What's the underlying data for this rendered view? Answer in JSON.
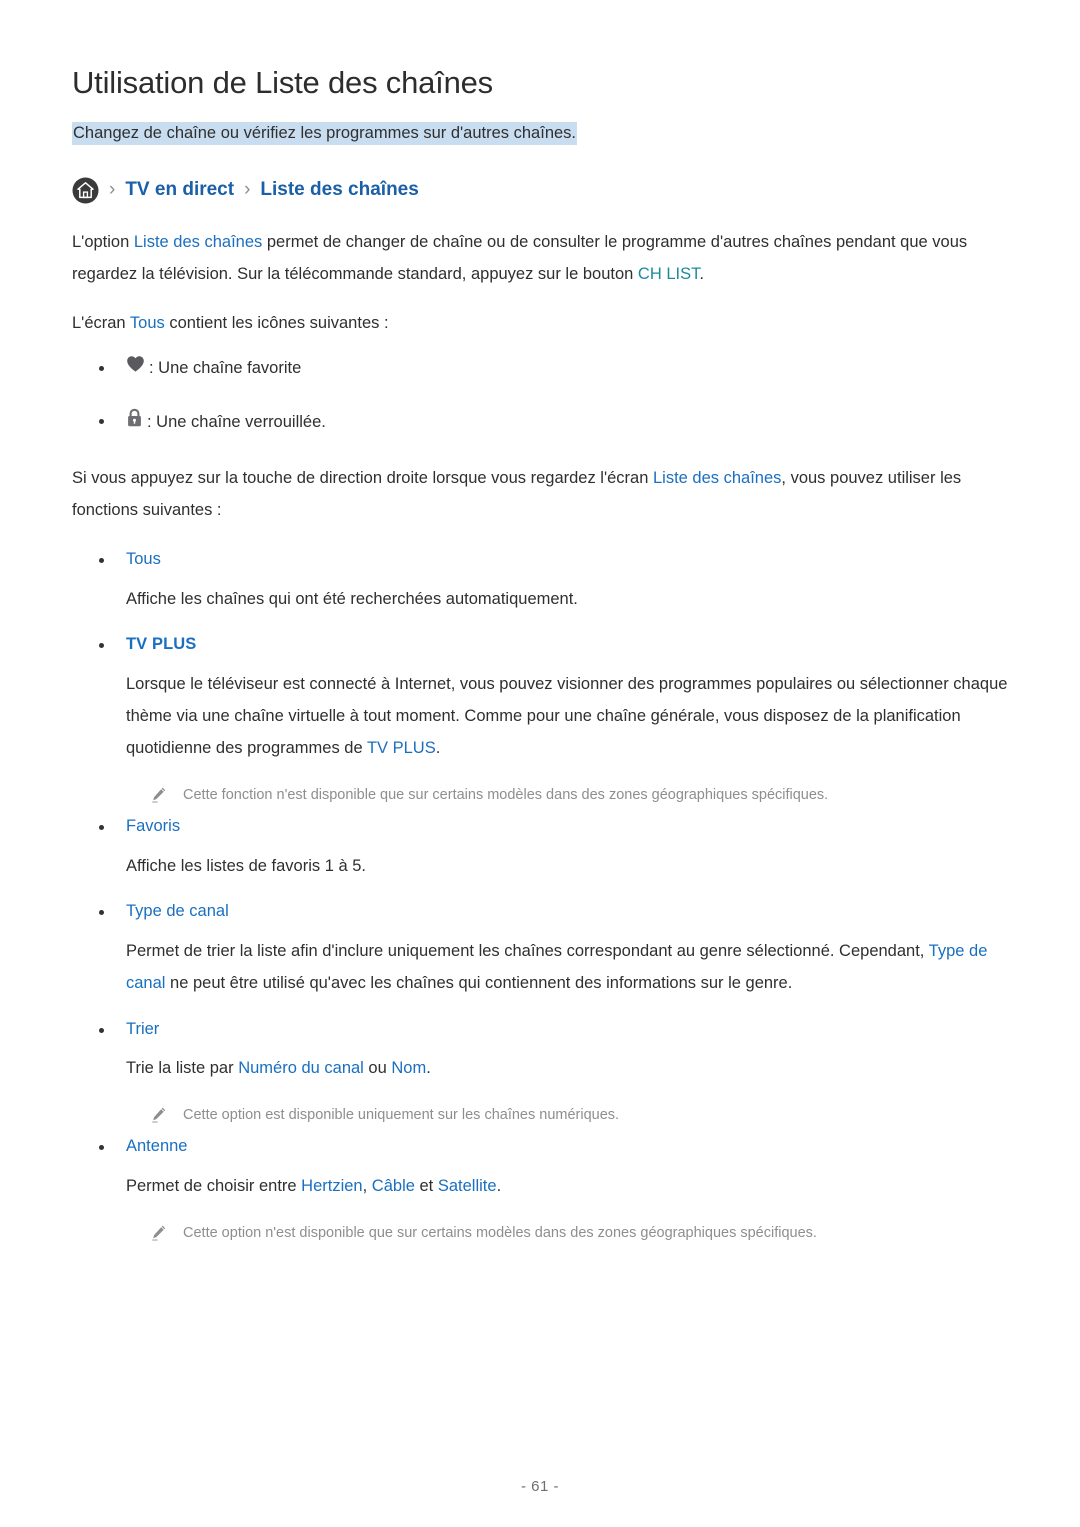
{
  "page": {
    "title": "Utilisation de Liste des chaînes",
    "subtitle": "Changez de chaîne ou vérifiez les programmes sur d'autres chaînes.",
    "footer": "- 61 -"
  },
  "colors": {
    "link": "#1a6fc0",
    "breadcrumb": "#1a5fa8",
    "teal": "#1b8a9c",
    "highlight": "#c9ddf1",
    "note_text": "#8e8e8e",
    "body_text": "#2f2f2f"
  },
  "breadcrumb": {
    "home_icon": "home-icon",
    "separator": "›",
    "items": [
      {
        "label": "TV en direct"
      },
      {
        "label": "Liste des chaînes"
      }
    ]
  },
  "intro": {
    "p1_part1": "L'option ",
    "p1_link1": "Liste des chaînes",
    "p1_part2": " permet de changer de chaîne ou de consulter le programme d'autres chaînes pendant que vous regardez la télévision. Sur la télécommande standard, appuyez sur le bouton ",
    "p1_link2": "CH LIST",
    "p1_part3": ".",
    "p2_part1": "L'écran ",
    "p2_link1": "Tous",
    "p2_part2": " contient les icônes suivantes :"
  },
  "icon_list": [
    {
      "icon": "heart-icon",
      "text": ": Une chaîne favorite"
    },
    {
      "icon": "lock-icon",
      "text": ": Une chaîne verrouillée."
    }
  ],
  "functions_intro": {
    "part1": "Si vous appuyez sur la touche de direction droite lorsque vous regardez l'écran ",
    "link1": "Liste des chaînes",
    "part2": ", vous pouvez utiliser les fonctions suivantes :"
  },
  "features": [
    {
      "title": "Tous",
      "bold": false,
      "desc_part1": "Affiche les chaînes qui ont été recherchées automatiquement.",
      "desc_link": "",
      "desc_part2": "",
      "note": ""
    },
    {
      "title": "TV PLUS",
      "bold": true,
      "desc_part1": "Lorsque le téléviseur est connecté à Internet, vous pouvez visionner des programmes populaires ou sélectionner chaque thème via une chaîne virtuelle à tout moment. Comme pour une chaîne générale, vous disposez de la planification quotidienne des programmes de ",
      "desc_link": "TV PLUS",
      "desc_part2": ".",
      "note": "Cette fonction n'est disponible que sur certains modèles dans des zones géographiques spécifiques."
    },
    {
      "title": "Favoris",
      "bold": false,
      "desc_part1": "Affiche les listes de favoris 1 à 5.",
      "desc_link": "",
      "desc_part2": "",
      "note": ""
    },
    {
      "title": "Type de canal",
      "bold": false,
      "desc_part1": "Permet de trier la liste afin d'inclure uniquement les chaînes correspondant au genre sélectionné. Cependant, ",
      "desc_link": "Type de canal",
      "desc_part2": " ne peut être utilisé qu'avec les chaînes qui contiennent des informations sur le genre.",
      "note": ""
    },
    {
      "title": "Trier",
      "bold": false,
      "desc_part1": "Trie la liste par ",
      "desc_link": "Numéro du canal",
      "desc_mid": " ou ",
      "desc_link2": "Nom",
      "desc_part2": ".",
      "note": "Cette option est disponible uniquement sur les chaînes numériques."
    },
    {
      "title": "Antenne",
      "bold": false,
      "desc_part1": "Permet de choisir entre ",
      "desc_link": "Hertzien",
      "desc_mid": ", ",
      "desc_link2": "Câble",
      "desc_mid2": " et ",
      "desc_link3": "Satellite",
      "desc_part2": ".",
      "note": "Cette option n'est disponible que sur certains modèles dans des zones géographiques spécifiques."
    }
  ]
}
